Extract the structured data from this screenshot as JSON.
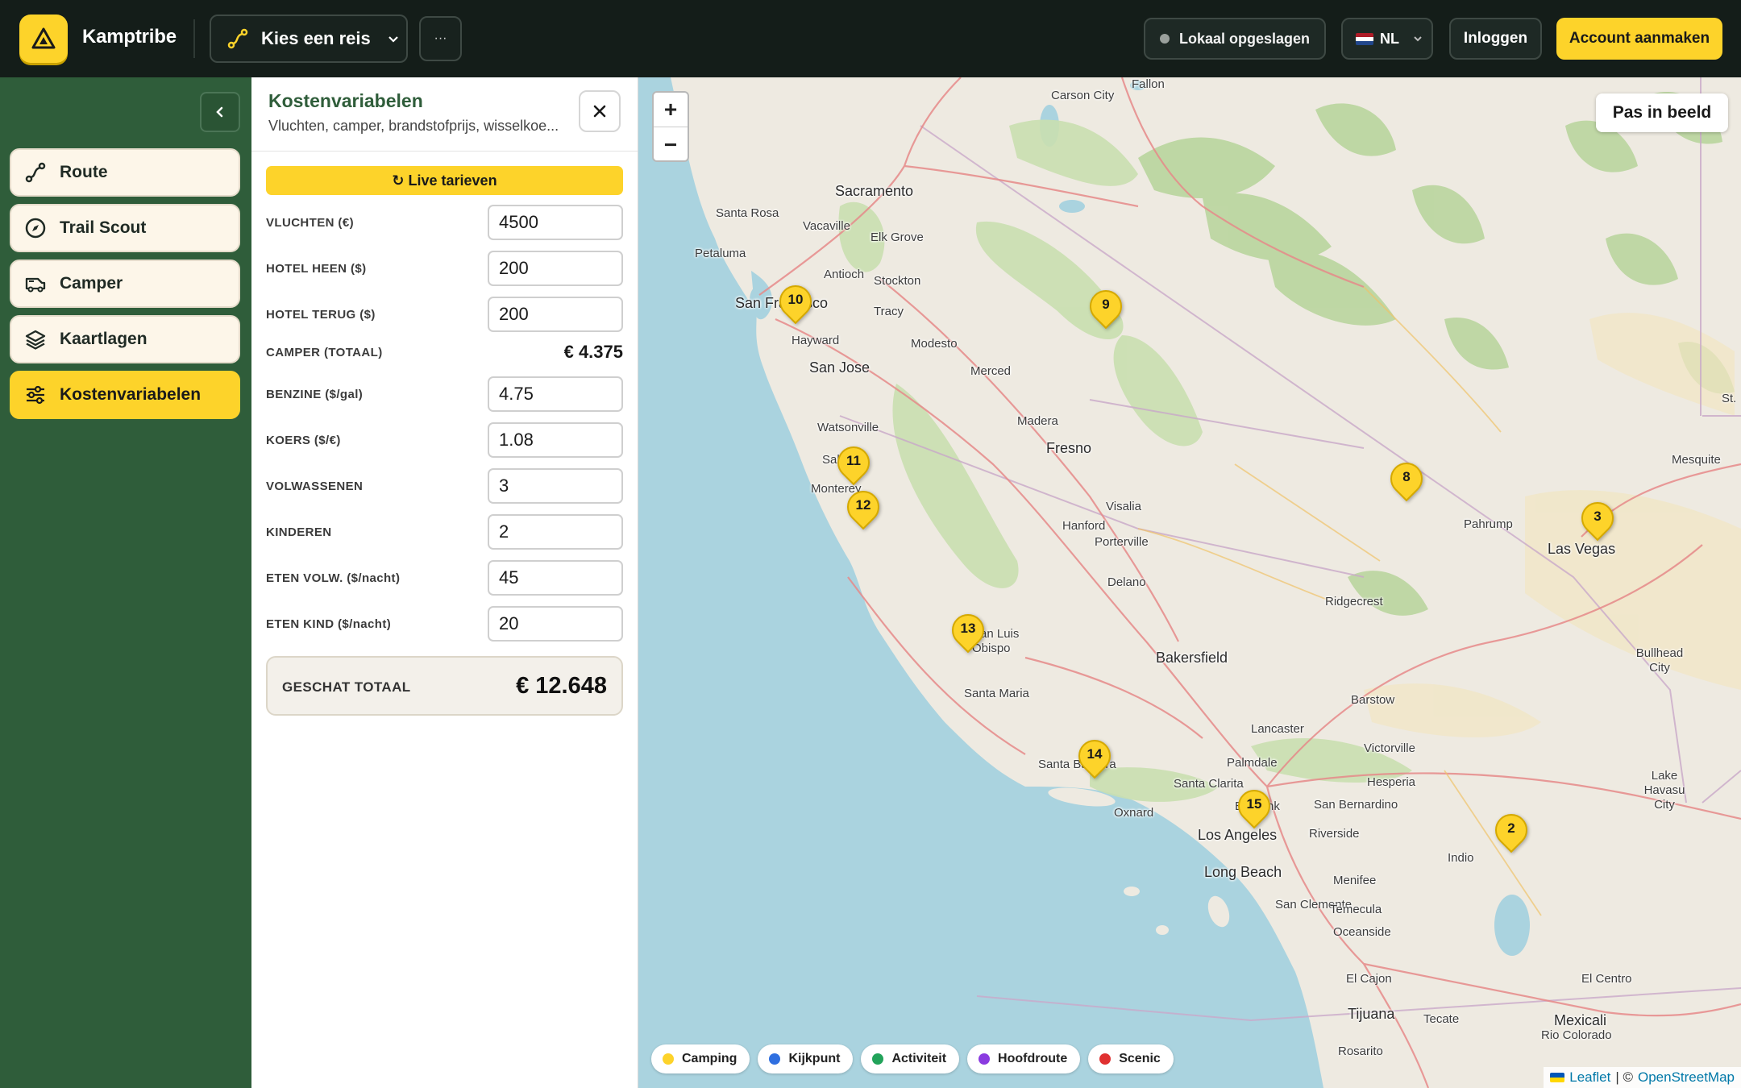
{
  "header": {
    "brand": "Kamptribe",
    "trip_select_label": "Kies een reis",
    "more_label": "···",
    "storage_status": "Lokaal opgeslagen",
    "language": "NL",
    "login_label": "Inloggen",
    "signup_label": "Account aanmaken"
  },
  "sidebar": {
    "items": [
      {
        "label": "Route",
        "icon": "route-icon"
      },
      {
        "label": "Trail Scout",
        "icon": "compass-icon"
      },
      {
        "label": "Camper",
        "icon": "camper-icon"
      },
      {
        "label": "Kaartlagen",
        "icon": "layers-icon"
      },
      {
        "label": "Kostenvariabelen",
        "icon": "sliders-icon",
        "active": true
      }
    ]
  },
  "panel": {
    "title": "Kostenvariabelen",
    "subtitle": "Vluchten, camper, brandstofprijs, wisselkoe...",
    "live_button": "↻ Live tarieven",
    "fields": [
      {
        "label": "VLUCHTEN (€)",
        "value": "4500"
      },
      {
        "label": "HOTEL HEEN ($)",
        "value": "200"
      },
      {
        "label": "HOTEL TERUG ($)",
        "value": "200"
      },
      {
        "label": "CAMPER (TOTAAL)",
        "value": "€ 4.375",
        "readonly": true
      },
      {
        "label": "BENZINE ($/gal)",
        "value": "4.75"
      },
      {
        "label": "KOERS ($/€)",
        "value": "1.08"
      },
      {
        "label": "VOLWASSENEN",
        "value": "3"
      },
      {
        "label": "KINDEREN",
        "value": "2"
      },
      {
        "label": "ETEN VOLW. ($/nacht)",
        "value": "45"
      },
      {
        "label": "ETEN KIND ($/nacht)",
        "value": "20"
      }
    ],
    "total_label": "GESCHAT TOTAAL",
    "total_value": "€ 12.648"
  },
  "map": {
    "fit_label": "Pas in beeld",
    "zoom_in": "+",
    "zoom_out": "−",
    "markers": [
      "10",
      "9",
      "11",
      "12",
      "8",
      "3",
      "13",
      "14",
      "15",
      "2"
    ],
    "places": [
      "Fallon",
      "Carson City",
      "Sacramento",
      "Santa Rosa",
      "Vacaville",
      "Elk Grove",
      "Petaluma",
      "Antioch",
      "Stockton",
      "San Francisco",
      "Tracy",
      "Hayward",
      "Modesto",
      "San Jose",
      "Merced",
      "Madera",
      "Watsonville",
      "Salinas",
      "Fresno",
      "Monterey",
      "Visalia",
      "Hanford",
      "Porterville",
      "Pahrump",
      "Las Vegas",
      "Mesquite",
      "Delano",
      "Ridgecrest",
      "San Luis Obispo",
      "Bakersfield",
      "Bullhead City",
      "Santa Maria",
      "Barstow",
      "Lancaster",
      "Victorville",
      "Palmdale",
      "Hesperia",
      "Santa Barbara",
      "Santa Clarita",
      "San Bernardino",
      "Lake Havasu City",
      "Oxnard",
      "Burbank",
      "Los Angeles",
      "Riverside",
      "Indio",
      "Long Beach",
      "Menifee",
      "San Clemente",
      "Temecula",
      "Oceanside",
      "El Centro",
      "El Cajon",
      "Tijuana",
      "Tecate",
      "Mexicali",
      "Rio Colorado",
      "Rosarito",
      "St."
    ],
    "attribution_leaflet": "Leaflet",
    "attribution_sep": "| ©",
    "attribution_osm": "OpenStreetMap"
  },
  "legend": [
    {
      "label": "Camping",
      "color": "#fdd32a"
    },
    {
      "label": "Kijkpunt",
      "color": "#2f6fe0"
    },
    {
      "label": "Activiteit",
      "color": "#22a35a"
    },
    {
      "label": "Hoofdroute",
      "color": "#8a3be0"
    },
    {
      "label": "Scenic",
      "color": "#e03131"
    }
  ],
  "colors": {
    "accent": "#fdd32a",
    "sidebar_green": "#2f5d3a",
    "topbar": "#141d19",
    "ocean": "#aad3df"
  }
}
